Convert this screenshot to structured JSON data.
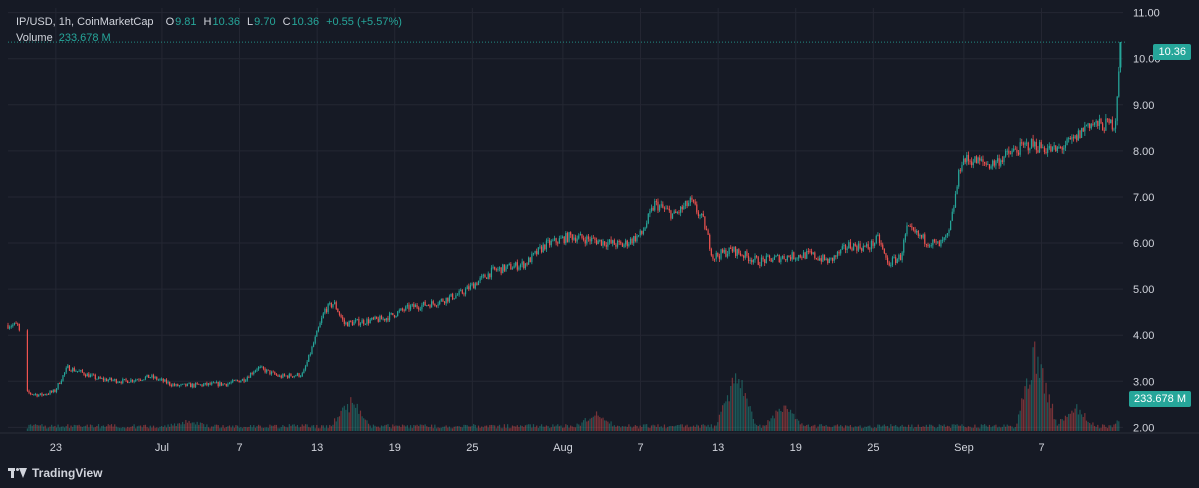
{
  "legend": {
    "symbol": "IP/USD, 1h, CoinMarketCap",
    "open_label": "O",
    "open": "9.81",
    "high_label": "H",
    "high": "10.36",
    "low_label": "L",
    "low": "9.70",
    "close_label": "C",
    "close": "10.36",
    "change": "+0.55 (+5.57%)",
    "volume_label": "Volume",
    "volume": "233.678 M"
  },
  "price_tag": "10.36",
  "volume_tag": "233.678 M",
  "footer": {
    "brand": "TradingView"
  },
  "colors": {
    "background": "#161a25",
    "up": "#26a69a",
    "down": "#ef5350",
    "grid": "#242733",
    "text": "#d1d4dc"
  },
  "chart_data": {
    "type": "candlestick",
    "title": "IP/USD, 1h, CoinMarketCap",
    "xlabel": "",
    "ylabel": "",
    "ylim": [
      1.9,
      11.1
    ],
    "y_ticks": [
      "11.00",
      "10.00",
      "9.00",
      "8.00",
      "7.00",
      "6.00",
      "5.00",
      "4.00",
      "3.00",
      "2.00"
    ],
    "x_ticks": [
      "23",
      "Jul",
      "7",
      "13",
      "19",
      "25",
      "Aug",
      "7",
      "13",
      "19",
      "25",
      "Sep",
      "7"
    ],
    "x_range_days": [
      0,
      76.5
    ],
    "tick_days": [
      3,
      11,
      18,
      24,
      30,
      36,
      42,
      49,
      55,
      61,
      67,
      73,
      80
    ],
    "price_path": [
      [
        0,
        4.22
      ],
      [
        0.8,
        4.22
      ],
      [
        1.5,
        2.75
      ],
      [
        2.5,
        2.7
      ],
      [
        3.6,
        2.78
      ],
      [
        4.6,
        3.3
      ],
      [
        5.6,
        3.2
      ],
      [
        7,
        3.05
      ],
      [
        9,
        3.0
      ],
      [
        11,
        3.1
      ],
      [
        12,
        3.0
      ],
      [
        13,
        2.9
      ],
      [
        15,
        2.92
      ],
      [
        17,
        2.95
      ],
      [
        18.3,
        3.05
      ],
      [
        19.3,
        3.3
      ],
      [
        21,
        3.1
      ],
      [
        22.8,
        3.15
      ],
      [
        23.6,
        3.8
      ],
      [
        24.5,
        4.55
      ],
      [
        25.2,
        4.7
      ],
      [
        26,
        4.25
      ],
      [
        27.5,
        4.3
      ],
      [
        29,
        4.35
      ],
      [
        31,
        4.6
      ],
      [
        33,
        4.7
      ],
      [
        35,
        4.9
      ],
      [
        37.5,
        5.4
      ],
      [
        40,
        5.55
      ],
      [
        41.5,
        5.95
      ],
      [
        43.5,
        6.15
      ],
      [
        45.5,
        6.05
      ],
      [
        47.5,
        5.95
      ],
      [
        49,
        6.2
      ],
      [
        50,
        6.85
      ],
      [
        51.5,
        6.6
      ],
      [
        52.8,
        6.9
      ],
      [
        53.8,
        6.45
      ],
      [
        54.5,
        5.7
      ],
      [
        56,
        5.85
      ],
      [
        58,
        5.6
      ],
      [
        60,
        5.7
      ],
      [
        62,
        5.75
      ],
      [
        63.5,
        5.6
      ],
      [
        65,
        5.95
      ],
      [
        66.5,
        5.9
      ],
      [
        67.3,
        6.1
      ],
      [
        68,
        5.55
      ],
      [
        69,
        5.7
      ],
      [
        69.5,
        6.3
      ],
      [
        71,
        6.05
      ],
      [
        72,
        5.95
      ],
      [
        72.7,
        6.15
      ],
      [
        73,
        6.6
      ],
      [
        73.7,
        7.8
      ],
      [
        74.5,
        7.8
      ],
      [
        76,
        7.7
      ],
      [
        77.5,
        7.95
      ],
      [
        79,
        8.15
      ],
      [
        81,
        8.0
      ],
      [
        82.5,
        8.25
      ],
      [
        83.5,
        8.6
      ],
      [
        84.5,
        8.55
      ],
      [
        85.6,
        8.6
      ],
      [
        86,
        10.36
      ]
    ],
    "volume_ylim": [
      0,
      233.678
    ],
    "volume_peaks": [
      [
        14,
        12
      ],
      [
        26.5,
        65
      ],
      [
        45.5,
        30
      ],
      [
        56.3,
        140
      ],
      [
        60,
        55
      ],
      [
        79.5,
        200
      ],
      [
        82.5,
        50
      ],
      [
        87,
        55
      ]
    ],
    "last": {
      "open": 9.81,
      "high": 10.36,
      "low": 9.7,
      "close": 10.36,
      "change": 0.55,
      "change_pct": 5.57
    },
    "last_volume": "233.678 M",
    "grid": true
  }
}
